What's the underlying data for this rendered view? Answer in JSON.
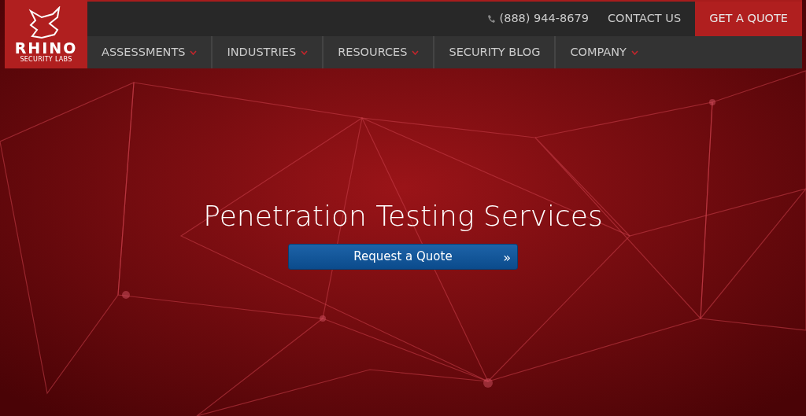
{
  "logo": {
    "name": "RHINO",
    "tagline": "SECURITY LABS"
  },
  "topbar": {
    "phone": "(888) 944-8679",
    "contact": "CONTACT US",
    "quote": "GET A QUOTE"
  },
  "nav": [
    {
      "label": "ASSESSMENTS",
      "dropdown": true
    },
    {
      "label": "INDUSTRIES",
      "dropdown": true
    },
    {
      "label": "RESOURCES",
      "dropdown": true
    },
    {
      "label": "SECURITY BLOG",
      "dropdown": false
    },
    {
      "label": "COMPANY",
      "dropdown": true
    }
  ],
  "hero": {
    "title": "Penetration Testing Services",
    "button": "Request a Quote",
    "button_icon": "»"
  }
}
